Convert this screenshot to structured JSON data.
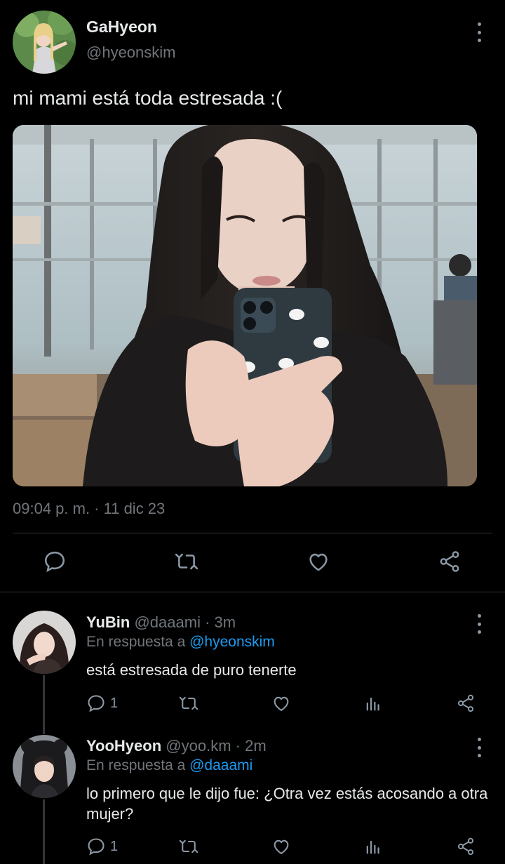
{
  "tweet": {
    "author_name": "GaHyeon",
    "author_handle": "@hyeonskim",
    "text": "mi mami está toda estresada :(",
    "timestamp": "09:04 p. m. · 11 dic 23",
    "actions": [
      "reply-icon",
      "retweet-icon",
      "like-icon",
      "share-icon"
    ]
  },
  "replies": [
    {
      "name": "YuBin",
      "handle": "@daaami",
      "time": "· 3m",
      "reply_prefix": "En respuesta a",
      "reply_to": "@hyeonskim",
      "text": "está estresada de puro tenerte",
      "reply_count": "1"
    },
    {
      "name": "YooHyeon",
      "handle": "@yoo.km",
      "time": "· 2m",
      "reply_prefix": "En respuesta a",
      "reply_to": "@daaami",
      "text": "lo primero que le dijo fue: ¿Otra vez estás acosando a otra mujer?",
      "reply_count": "1"
    }
  ],
  "colors": {
    "background": "#000000",
    "text_primary": "#e7e9ea",
    "text_secondary": "#71767b",
    "accent": "#1d9bf0",
    "divider": "#2f3336"
  }
}
